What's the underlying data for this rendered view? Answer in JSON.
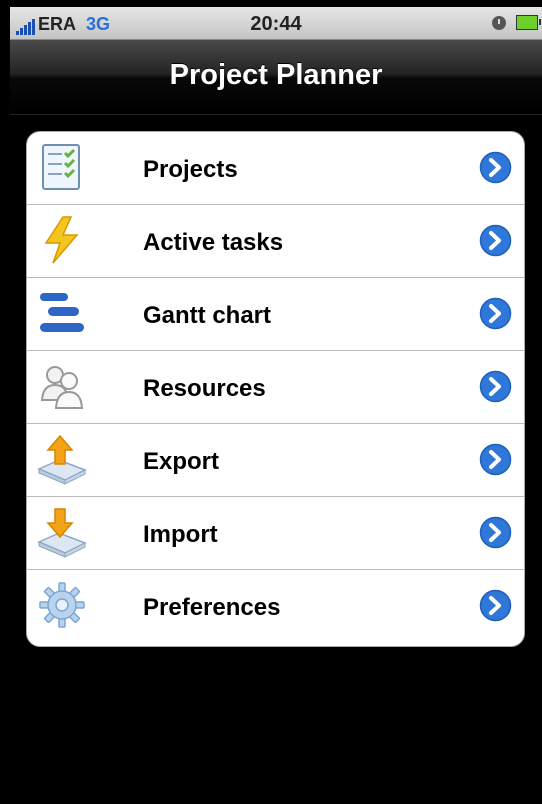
{
  "status_bar": {
    "carrier": "ERA",
    "network": "3G",
    "time": "20:44",
    "icons": [
      "signal-icon",
      "clock-icon",
      "battery-charging-icon"
    ]
  },
  "nav_bar": {
    "title": "Project Planner"
  },
  "menu": {
    "items": [
      {
        "label": "Projects",
        "icon": "checklist-icon"
      },
      {
        "label": "Active tasks",
        "icon": "lightning-icon"
      },
      {
        "label": "Gantt chart",
        "icon": "gantt-icon"
      },
      {
        "label": "Resources",
        "icon": "users-icon"
      },
      {
        "label": "Export",
        "icon": "export-icon"
      },
      {
        "label": "Import",
        "icon": "import-icon"
      },
      {
        "label": "Preferences",
        "icon": "gear-icon"
      }
    ],
    "accessory_icon": "chevron-right-icon"
  },
  "colors": {
    "status_background": "#d3d3d3",
    "nav_background": "#000000",
    "page_background": "#000000",
    "card_background": "#ffffff",
    "disclosure_blue": "#2f77d8"
  }
}
